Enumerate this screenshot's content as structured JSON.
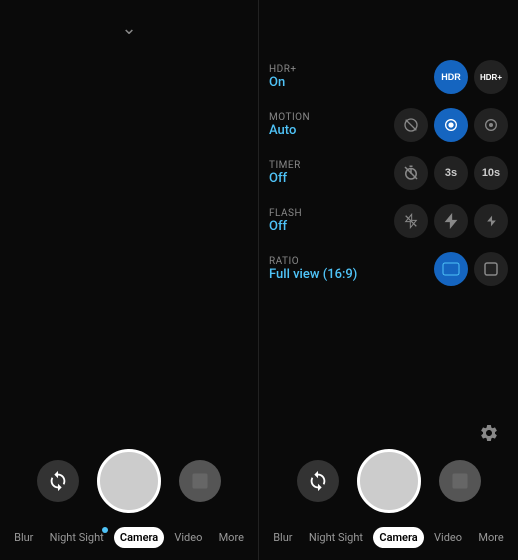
{
  "panels": {
    "left": {
      "chevron": "˅",
      "gallery_btn_label": "gallery",
      "shutter_btn_label": "shutter",
      "flip_btn_label": "flip camera",
      "modes": [
        {
          "id": "blur",
          "label": "Blur",
          "active": false,
          "dot": false
        },
        {
          "id": "night-sight",
          "label": "Night Sight",
          "active": false,
          "dot": true
        },
        {
          "id": "camera",
          "label": "Camera",
          "active": true,
          "dot": false
        },
        {
          "id": "video",
          "label": "Video",
          "active": false,
          "dot": false
        },
        {
          "id": "more",
          "label": "More",
          "active": false,
          "dot": false
        }
      ]
    },
    "right": {
      "settings": [
        {
          "id": "hdr",
          "label": "HDR+",
          "value": "On",
          "options": [
            {
              "id": "hdr-auto",
              "icon": "HDR",
              "active": true,
              "type": "icon"
            },
            {
              "id": "hdr-plus",
              "icon": "HDR+",
              "active": false,
              "type": "text"
            }
          ]
        },
        {
          "id": "motion",
          "label": "MOTION",
          "value": "Auto",
          "options": [
            {
              "id": "motion-off",
              "icon": "⊘",
              "active": false,
              "type": "icon"
            },
            {
              "id": "motion-auto",
              "icon": "◎",
              "active": true,
              "type": "icon"
            },
            {
              "id": "motion-on",
              "icon": "●",
              "active": false,
              "type": "icon"
            }
          ]
        },
        {
          "id": "timer",
          "label": "TIMER",
          "value": "Off",
          "options": [
            {
              "id": "timer-off",
              "icon": "⏱",
              "active": false,
              "type": "icon",
              "strikethrough": true
            },
            {
              "id": "timer-3s",
              "icon": "3s",
              "active": false,
              "type": "text"
            },
            {
              "id": "timer-10s",
              "icon": "10s",
              "active": false,
              "type": "text"
            }
          ]
        },
        {
          "id": "flash",
          "label": "FLASH",
          "value": "Off",
          "options": [
            {
              "id": "flash-off",
              "icon": "⚡",
              "active": false,
              "type": "icon",
              "strikethrough": true
            },
            {
              "id": "flash-auto",
              "icon": "⚡",
              "active": false,
              "type": "icon"
            },
            {
              "id": "flash-on",
              "icon": "⚡",
              "active": false,
              "type": "icon"
            }
          ]
        },
        {
          "id": "ratio",
          "label": "RATIO",
          "value": "Full view (16:9)",
          "options": [
            {
              "id": "ratio-full",
              "icon": "▭",
              "active": true,
              "type": "icon"
            },
            {
              "id": "ratio-square",
              "icon": "▢",
              "active": false,
              "type": "icon"
            }
          ]
        }
      ],
      "gear_label": "settings",
      "modes": [
        {
          "id": "blur",
          "label": "Blur",
          "active": false,
          "dot": false
        },
        {
          "id": "night-sight",
          "label": "Night Sight",
          "active": false,
          "dot": false
        },
        {
          "id": "camera",
          "label": "Camera",
          "active": true,
          "dot": false
        },
        {
          "id": "video",
          "label": "Video",
          "active": false,
          "dot": false
        },
        {
          "id": "more",
          "label": "More",
          "active": false,
          "dot": false
        }
      ]
    }
  }
}
